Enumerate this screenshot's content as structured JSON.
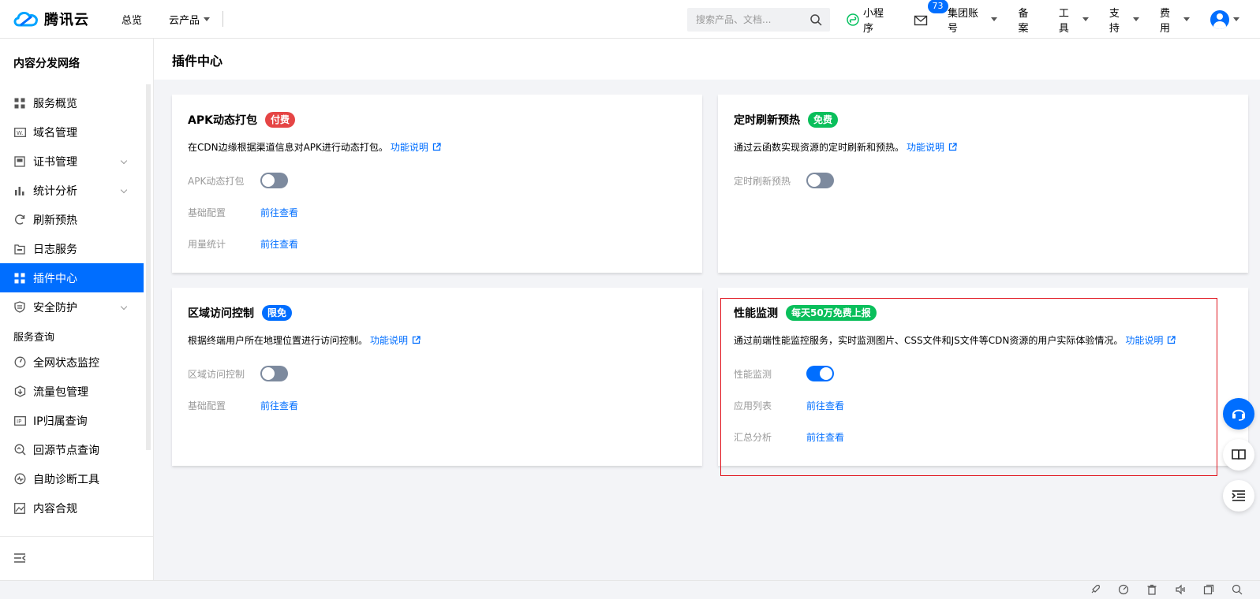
{
  "brand": {
    "name": "腾讯云"
  },
  "topnav": {
    "overview": "总览",
    "products": "云产品"
  },
  "search": {
    "placeholder": "搜索产品、文档..."
  },
  "rightnav": {
    "miniprogram": "小程序",
    "mail_count": "73",
    "group_account": "集团账号",
    "icp": "备案",
    "tools": "工具",
    "support": "支持",
    "billing": "费用"
  },
  "sidebar": {
    "title": "内容分发网络",
    "items": [
      {
        "label": "服务概览",
        "icon": "grid-icon"
      },
      {
        "label": "域名管理",
        "icon": "domain-icon"
      },
      {
        "label": "证书管理",
        "icon": "certificate-icon",
        "expandable": true
      },
      {
        "label": "统计分析",
        "icon": "bar-chart-icon",
        "expandable": true
      },
      {
        "label": "刷新预热",
        "icon": "refresh-icon"
      },
      {
        "label": "日志服务",
        "icon": "log-icon"
      },
      {
        "label": "插件中心",
        "icon": "plugin-icon",
        "active": true
      },
      {
        "label": "安全防护",
        "icon": "shield-icon",
        "expandable": true
      }
    ],
    "section_label": "服务查询",
    "query_items": [
      {
        "label": "全网状态监控",
        "icon": "monitor-icon"
      },
      {
        "label": "流量包管理",
        "icon": "traffic-icon"
      },
      {
        "label": "IP归属查询",
        "icon": "ip-icon"
      },
      {
        "label": "回源节点查询",
        "icon": "search-node-icon"
      },
      {
        "label": "自助诊断工具",
        "icon": "diagnose-icon"
      },
      {
        "label": "内容合规",
        "icon": "image-icon"
      }
    ]
  },
  "page": {
    "title": "插件中心"
  },
  "cards": [
    {
      "title": "APK动态打包",
      "tag": "付费",
      "tag_color": "#e54545",
      "desc": "在CDN边缘根据渠道信息对APK进行动态打包。",
      "link": "功能说明",
      "toggle_label": "APK动态打包",
      "toggle_on": false,
      "rows": [
        {
          "label": "基础配置",
          "value": "前往查看"
        },
        {
          "label": "用量统计",
          "value": "前往查看"
        }
      ]
    },
    {
      "title": "定时刷新预热",
      "tag": "免费",
      "tag_color": "#0abf5b",
      "desc": "通过云函数实现资源的定时刷新和预热。",
      "link": "功能说明",
      "toggle_label": "定时刷新预热",
      "toggle_on": false,
      "rows": []
    },
    {
      "title": "区域访问控制",
      "tag": "限免",
      "tag_color": "#006eff",
      "desc": "根据终端用户所在地理位置进行访问控制。",
      "link": "功能说明",
      "toggle_label": "区域访问控制",
      "toggle_on": false,
      "rows": [
        {
          "label": "基础配置",
          "value": "前往查看"
        }
      ]
    },
    {
      "title": "性能监测",
      "tag": "每天50万免费上报",
      "tag_color": "#0abf5b",
      "desc": "通过前端性能监控服务，实时监测图片、CSS文件和JS文件等CDN资源的用户实际体验情况。",
      "link": "功能说明",
      "toggle_label": "性能监测",
      "toggle_on": true,
      "rows": [
        {
          "label": "应用列表",
          "value": "前往查看"
        },
        {
          "label": "汇总分析",
          "value": "前往查看"
        }
      ]
    }
  ],
  "floating": [
    "headset-icon",
    "book-icon",
    "outline-icon"
  ],
  "statusbar_icons": [
    "rocket-icon",
    "speed-icon",
    "trash-icon",
    "sound-icon",
    "window-icon",
    "search-icon"
  ]
}
